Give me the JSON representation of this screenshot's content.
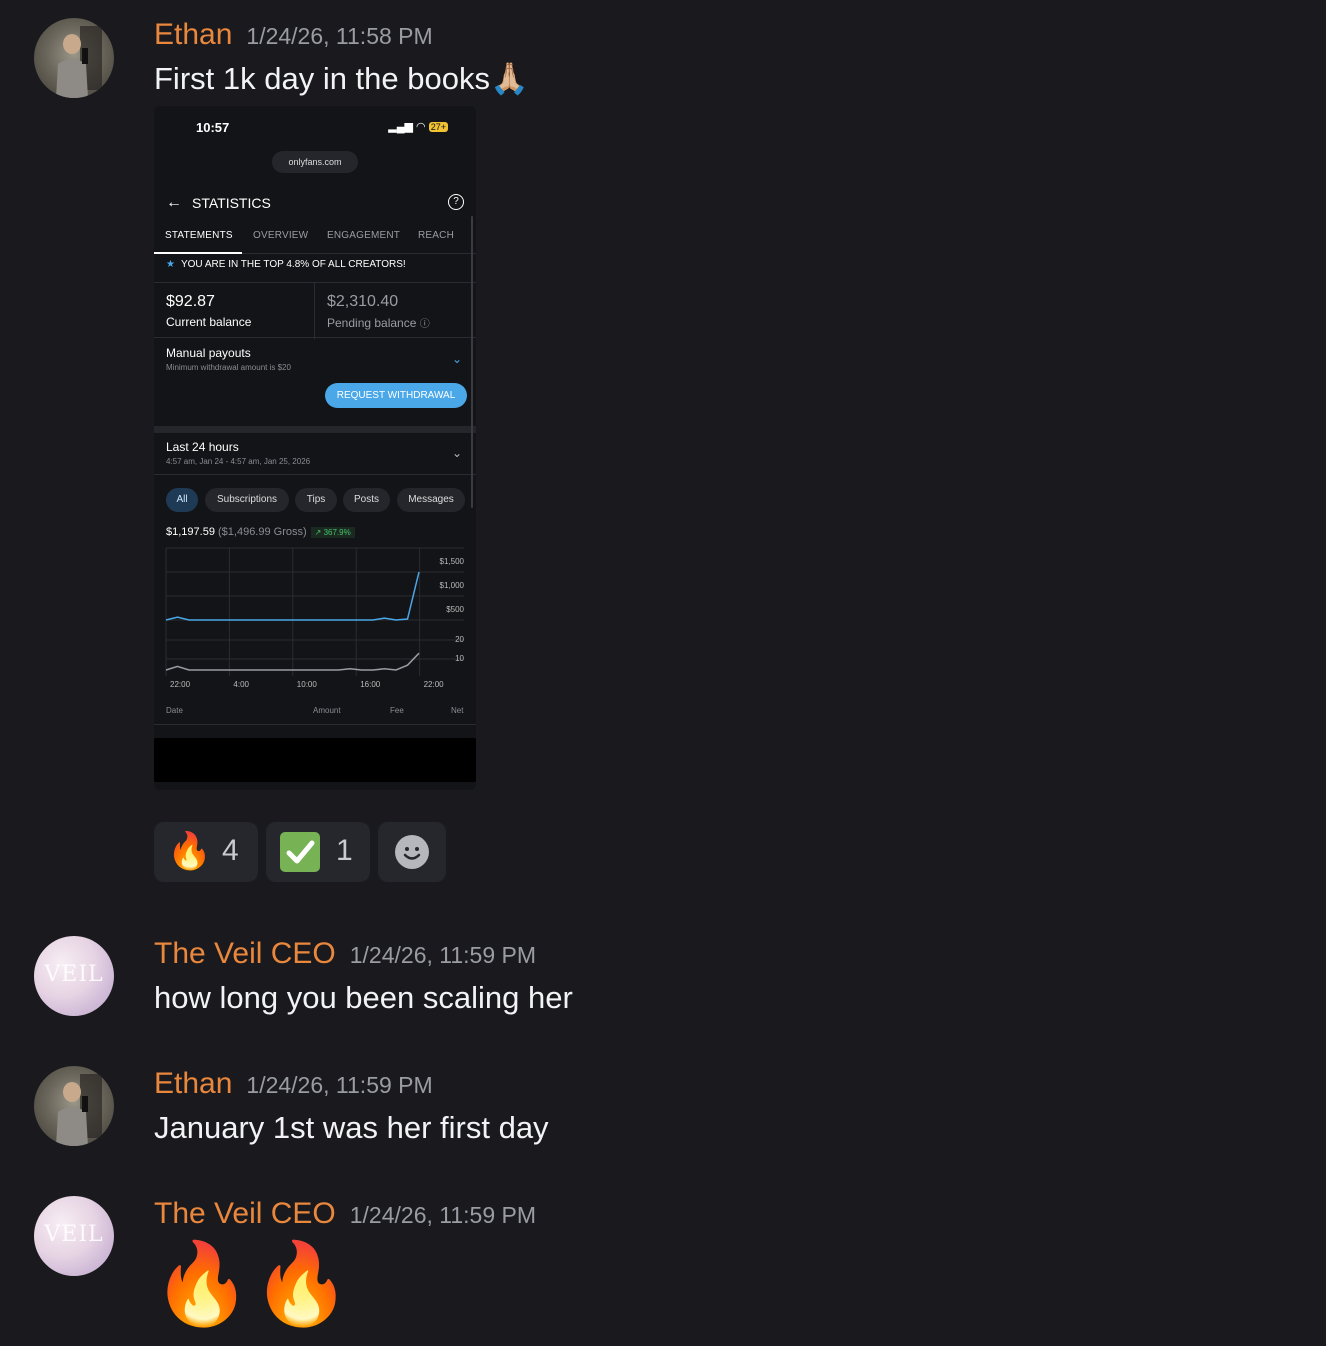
{
  "messages": [
    {
      "author": "Ethan",
      "timestamp": "1/24/26, 11:58 PM",
      "text": "First 1k day in the books",
      "emoji": "🙏🏼"
    },
    {
      "author": "The Veil CEO",
      "timestamp": "1/24/26, 11:59 PM",
      "text": "how long you been scaling her"
    },
    {
      "author": "Ethan",
      "timestamp": "1/24/26, 11:59 PM",
      "text": "January 1st was her first day"
    },
    {
      "author": "The Veil CEO",
      "timestamp": "1/24/26, 11:59 PM",
      "text": "🔥🔥"
    }
  ],
  "avatar_veil_text": "VEIL",
  "screenshot": {
    "time": "10:57",
    "battery": "27+",
    "url": "onlyfans.com",
    "title": "STATISTICS",
    "tabs": [
      "STATEMENTS",
      "OVERVIEW",
      "ENGAGEMENT",
      "REACH"
    ],
    "active_tab": "STATEMENTS",
    "top_banner": "YOU ARE IN THE TOP 4.8% OF ALL CREATORS!",
    "current_balance": "$92.87",
    "current_balance_label": "Current balance",
    "pending_balance": "$2,310.40",
    "pending_balance_label": "Pending balance",
    "manual_payouts": "Manual payouts",
    "min_withdrawal": "Minimum withdrawal amount is $20",
    "request_button": "REQUEST WITHDRAWAL",
    "range_title": "Last 24 hours",
    "range_sub": "4:57 am, Jan 24 - 4:57 am, Jan 25, 2026",
    "filters": [
      "All",
      "Subscriptions",
      "Tips",
      "Posts",
      "Messages"
    ],
    "active_filter": "All",
    "net": "$1,197.59",
    "gross": "($1,496.99 Gross)",
    "change": "↗ 367.9%",
    "table_headers": [
      "Date",
      "Amount",
      "Fee",
      "Net"
    ],
    "colors": {
      "accent": "#4aa8e8",
      "positive": "#45c26b"
    }
  },
  "chart_data": {
    "type": "line",
    "x": [
      "22:00",
      "4:00",
      "10:00",
      "16:00",
      "22:00"
    ],
    "y_ticks_upper": [
      "$1,500",
      "$1,000",
      "$500"
    ],
    "y_ticks_lower": [
      "20",
      "10"
    ],
    "series": [
      {
        "values": [
          0,
          60,
          0,
          0,
          0,
          0,
          0,
          0,
          0,
          0,
          0,
          0,
          0,
          0,
          0,
          0,
          0,
          0,
          0,
          40,
          0,
          20,
          1000
        ]
      },
      {
        "values": [
          0,
          3,
          0,
          0,
          0,
          0,
          0,
          0,
          0,
          0,
          0,
          0,
          0,
          0,
          0,
          0,
          1,
          0,
          0,
          1,
          0,
          4,
          14
        ]
      }
    ],
    "ylim_upper": [
      0,
      1500
    ],
    "ylim_lower": [
      0,
      25
    ]
  },
  "reactions": [
    {
      "emoji": "🔥",
      "count": "4"
    },
    {
      "emoji": "✅",
      "count": "1"
    },
    {
      "emoji": "add-reaction",
      "count": ""
    }
  ]
}
